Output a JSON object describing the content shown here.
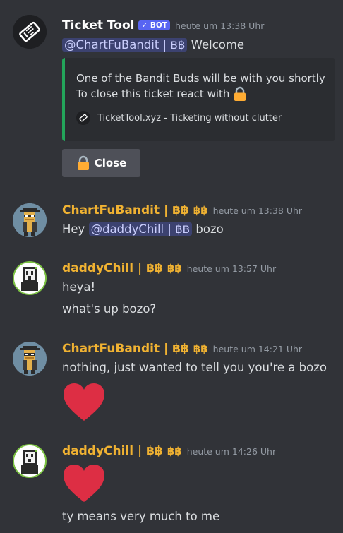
{
  "colors": {
    "background": "#313338",
    "ticket_author": "#ffffff",
    "member_author": "#f0b232",
    "mention_bg": "#3c4270",
    "embed_accent": "#23a55a",
    "button_bg": "#4e5058",
    "heart": "#dd2e44"
  },
  "messages": [
    {
      "author": "Ticket Tool",
      "bot_tag": "✓ BOT",
      "timestamp": "heute um 13:38 Uhr",
      "mention": "@ChartFuBandit | ฿฿",
      "text": " Welcome",
      "embed": {
        "line1": "One of the Bandit Buds will be with you shortly",
        "line2": "To close this ticket react with",
        "footer": "TicketTool.xyz - Ticketing without clutter"
      },
      "button": {
        "label": "Close",
        "icon": "lock-icon"
      }
    },
    {
      "author": "ChartFuBandit | ฿฿",
      "role_icon": "฿฿",
      "timestamp": "heute um 13:38 Uhr",
      "prefix": "Hey ",
      "mention": "@daddyChill | ฿฿",
      "suffix": " bozo"
    },
    {
      "author": "daddyChill | ฿฿",
      "role_icon": "฿฿",
      "timestamp": "heute um 13:57 Uhr",
      "lines": [
        "heya!",
        "what's up bozo?"
      ]
    },
    {
      "author": "ChartFuBandit | ฿฿",
      "role_icon": "฿฿",
      "timestamp": "heute um 14:21 Uhr",
      "lines": [
        "nothing, just wanted to tell you you're a bozo"
      ],
      "emoji": "heart-icon"
    },
    {
      "author": "daddyChill | ฿฿",
      "role_icon": "฿฿",
      "timestamp": "heute um 14:26 Uhr",
      "emoji": "heart-icon",
      "lines": [
        "ty means very much to me"
      ]
    }
  ]
}
